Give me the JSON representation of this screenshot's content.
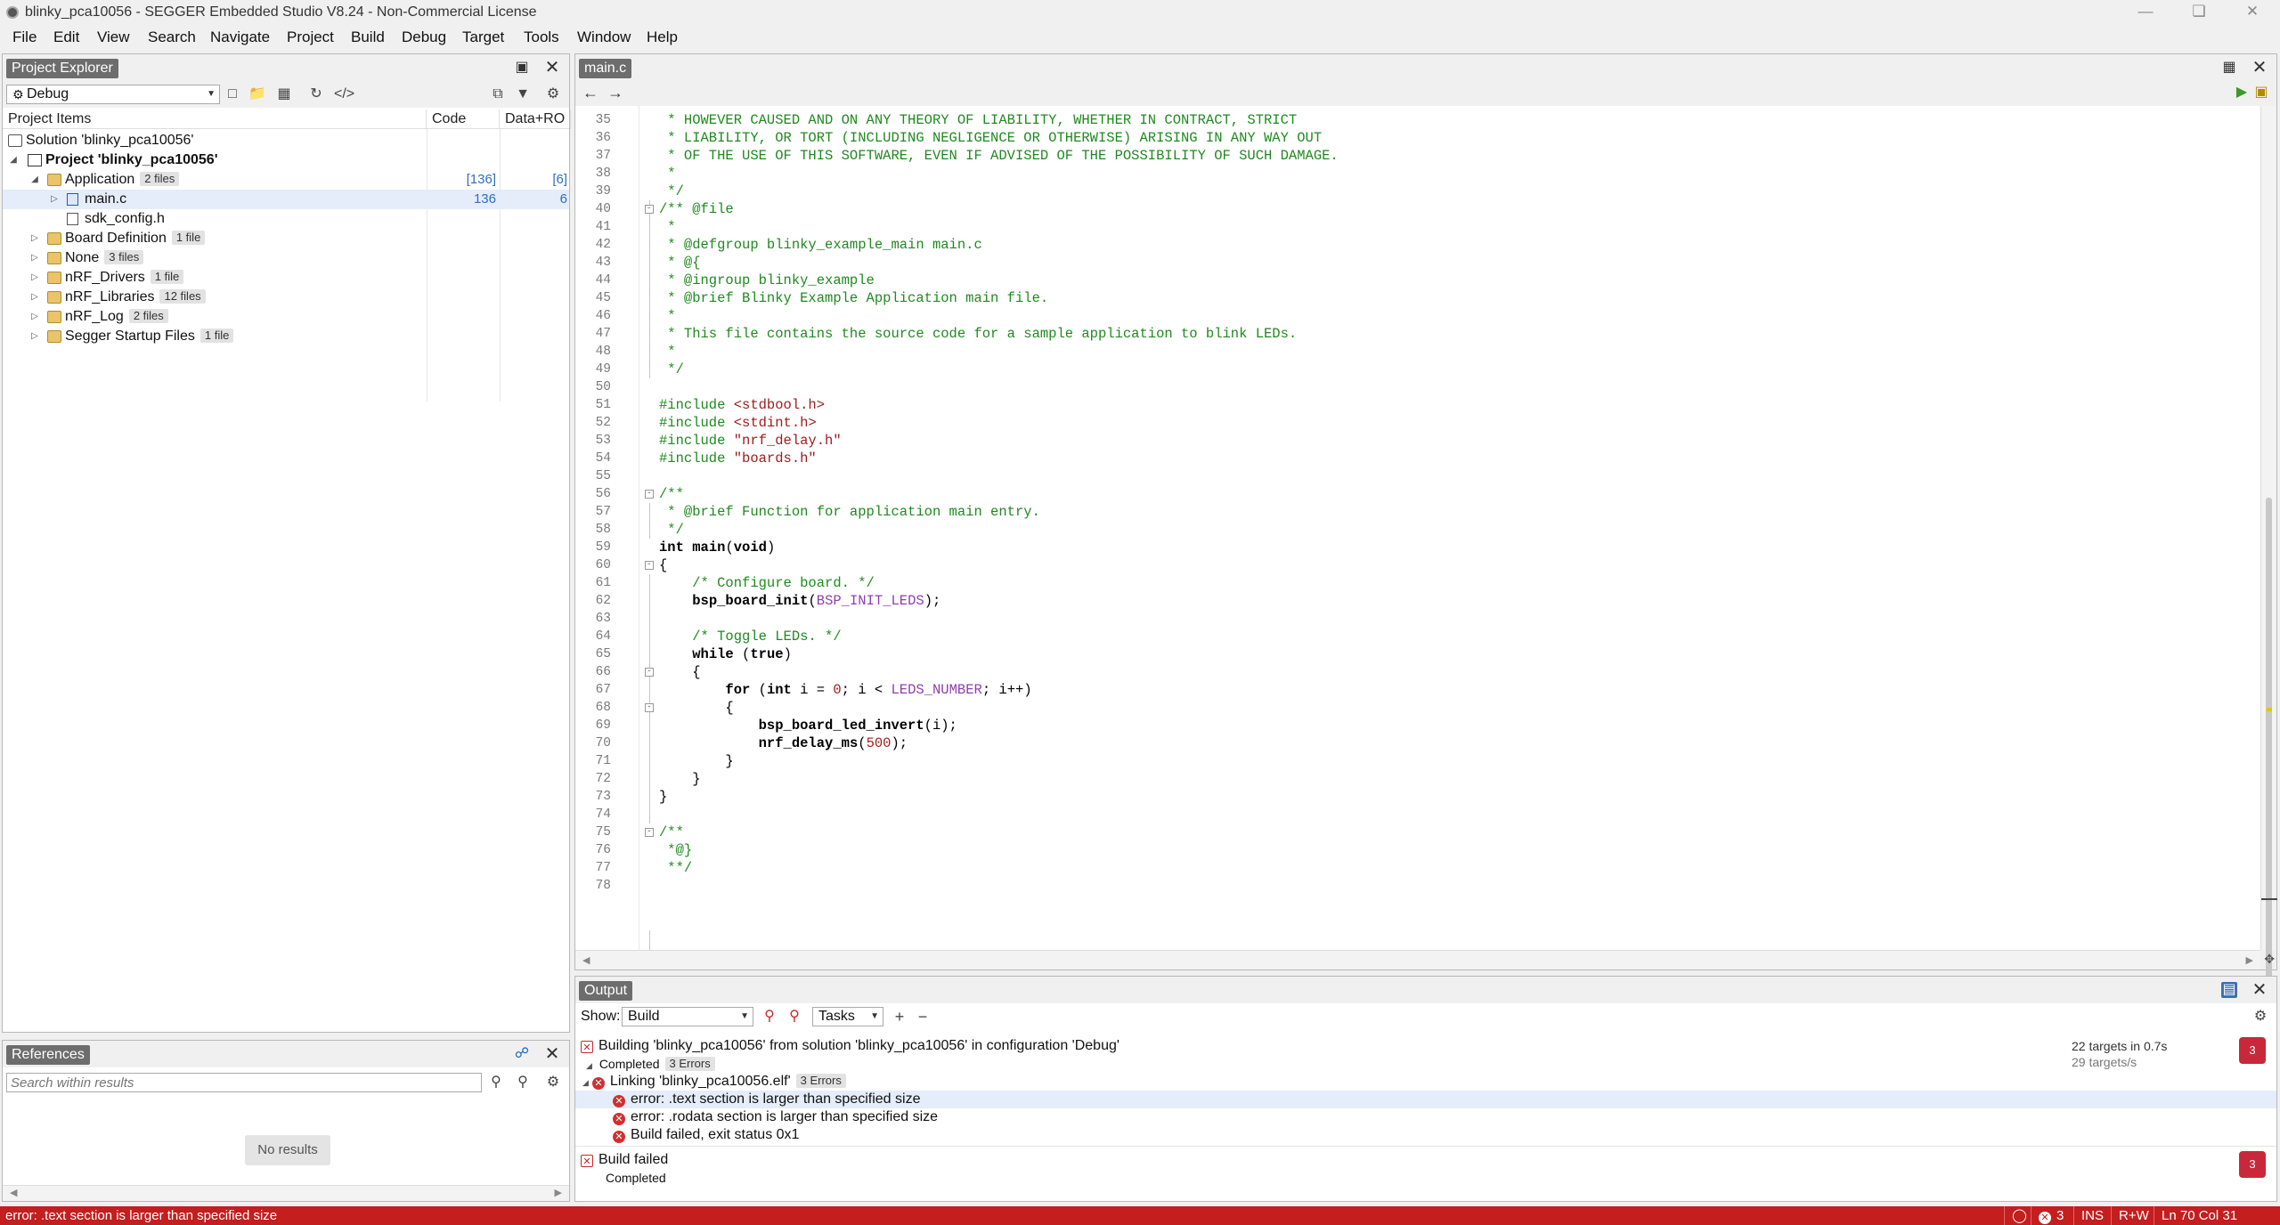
{
  "window": {
    "title": "blinky_pca10056 - SEGGER Embedded Studio V8.24 - Non-Commercial License"
  },
  "menu": [
    "File",
    "Edit",
    "View",
    "Search",
    "Navigate",
    "Project",
    "Build",
    "Debug",
    "Target",
    "Tools",
    "Window",
    "Help"
  ],
  "project_explorer": {
    "title": "Project Explorer",
    "configuration": "Debug",
    "columns": {
      "items": "Project Items",
      "code": "Code",
      "data": "Data+RO"
    },
    "tree": [
      {
        "label": "Solution 'blinky_pca10056'",
        "badge": "",
        "code": "",
        "data": ""
      },
      {
        "label": "Project 'blinky_pca10056'",
        "badge": "",
        "code": "",
        "data": ""
      },
      {
        "label": "Application",
        "badge": "2 files",
        "code": "[136]",
        "data": "[6]"
      },
      {
        "label": "main.c",
        "badge": "",
        "code": "136",
        "data": "6"
      },
      {
        "label": "sdk_config.h",
        "badge": "",
        "code": "",
        "data": ""
      },
      {
        "label": "Board Definition",
        "badge": "1 file",
        "code": "",
        "data": ""
      },
      {
        "label": "None",
        "badge": "3 files",
        "code": "",
        "data": ""
      },
      {
        "label": "nRF_Drivers",
        "badge": "1 file",
        "code": "",
        "data": ""
      },
      {
        "label": "nRF_Libraries",
        "badge": "12 files",
        "code": "",
        "data": ""
      },
      {
        "label": "nRF_Log",
        "badge": "2 files",
        "code": "",
        "data": ""
      },
      {
        "label": "Segger Startup Files",
        "badge": "1 file",
        "code": "",
        "data": ""
      }
    ]
  },
  "references": {
    "title": "References",
    "search_placeholder": "Search within results",
    "empty_text": "No results"
  },
  "editor": {
    "tab": "main.c",
    "lines": [
      {
        "n": "35",
        "text": " * HOWEVER CAUSED AND ON ANY THEORY OF LIABILITY, WHETHER IN CONTRACT, STRICT"
      },
      {
        "n": "36",
        "text": " * LIABILITY, OR TORT (INCLUDING NEGLIGENCE OR OTHERWISE) ARISING IN ANY WAY OUT"
      },
      {
        "n": "37",
        "text": " * OF THE USE OF THIS SOFTWARE, EVEN IF ADVISED OF THE POSSIBILITY OF SUCH DAMAGE."
      },
      {
        "n": "38",
        "text": " *"
      },
      {
        "n": "39",
        "text": " */"
      },
      {
        "n": "40",
        "text": "/** @file"
      },
      {
        "n": "41",
        "text": " *"
      },
      {
        "n": "42",
        "text": " * @defgroup blinky_example_main main.c"
      },
      {
        "n": "43",
        "text": " * @{"
      },
      {
        "n": "44",
        "text": " * @ingroup blinky_example"
      },
      {
        "n": "45",
        "text": " * @brief Blinky Example Application main file."
      },
      {
        "n": "46",
        "text": " *"
      },
      {
        "n": "47",
        "text": " * This file contains the source code for a sample application to blink LEDs."
      },
      {
        "n": "48",
        "text": " *"
      },
      {
        "n": "49",
        "text": " */"
      },
      {
        "n": "50",
        "text": ""
      },
      {
        "n": "51",
        "text": "#include <stdbool.h>"
      },
      {
        "n": "52",
        "text": "#include <stdint.h>"
      },
      {
        "n": "53",
        "text": "#include \"nrf_delay.h\""
      },
      {
        "n": "54",
        "text": "#include \"boards.h\""
      },
      {
        "n": "55",
        "text": ""
      },
      {
        "n": "56",
        "text": "/**"
      },
      {
        "n": "57",
        "text": " * @brief Function for application main entry."
      },
      {
        "n": "58",
        "text": " */"
      },
      {
        "n": "59",
        "text": "int main(void)"
      },
      {
        "n": "60",
        "text": "{"
      },
      {
        "n": "61",
        "text": "    /* Configure board. */"
      },
      {
        "n": "62",
        "text": "    bsp_board_init(BSP_INIT_LEDS);"
      },
      {
        "n": "63",
        "text": ""
      },
      {
        "n": "64",
        "text": "    /* Toggle LEDs. */"
      },
      {
        "n": "65",
        "text": "    while (true)"
      },
      {
        "n": "66",
        "text": "    {"
      },
      {
        "n": "67",
        "text": "        for (int i = 0; i < LEDS_NUMBER; i++)"
      },
      {
        "n": "68",
        "text": "        {"
      },
      {
        "n": "69",
        "text": "            bsp_board_led_invert(i);"
      },
      {
        "n": "70",
        "text": "            nrf_delay_ms(500);"
      },
      {
        "n": "71",
        "text": "        }"
      },
      {
        "n": "72",
        "text": "    }"
      },
      {
        "n": "73",
        "text": "}"
      },
      {
        "n": "74",
        "text": ""
      },
      {
        "n": "75",
        "text": "/**"
      },
      {
        "n": "76",
        "text": " *@}"
      },
      {
        "n": "77",
        "text": " **/"
      },
      {
        "n": "78",
        "text": ""
      }
    ]
  },
  "output": {
    "title": "Output",
    "show_label": "Show:",
    "show_value": "Build",
    "tasks_value": "Tasks",
    "build_line": "Building 'blinky_pca10056' from solution 'blinky_pca10056' in configuration 'Debug'",
    "build_status": "Completed",
    "build_errors": "3 Errors",
    "targets_count": "22 targets in 0.7s",
    "targets_rate": "29 targets/s",
    "build_badge": "3",
    "link_line": "Linking 'blinky_pca10056.elf'",
    "link_errors": "3 Errors",
    "errors": [
      "error: .text section is larger than specified size",
      "error: .rodata section is larger than specified size",
      "Build failed, exit status 0x1"
    ],
    "failed_line": "Build failed",
    "failed_status": "Completed",
    "failed_badge": "3"
  },
  "statusbar": {
    "message": "error: .text section is larger than specified size",
    "error_count": "3",
    "mode": "INS",
    "access": "R+W",
    "position": "Ln 70 Col 31"
  },
  "colors": {
    "status_error": "#c41e1e",
    "comment": "#1f8a1f",
    "string": "#a01d1d",
    "macro": "#8e3fb0"
  }
}
